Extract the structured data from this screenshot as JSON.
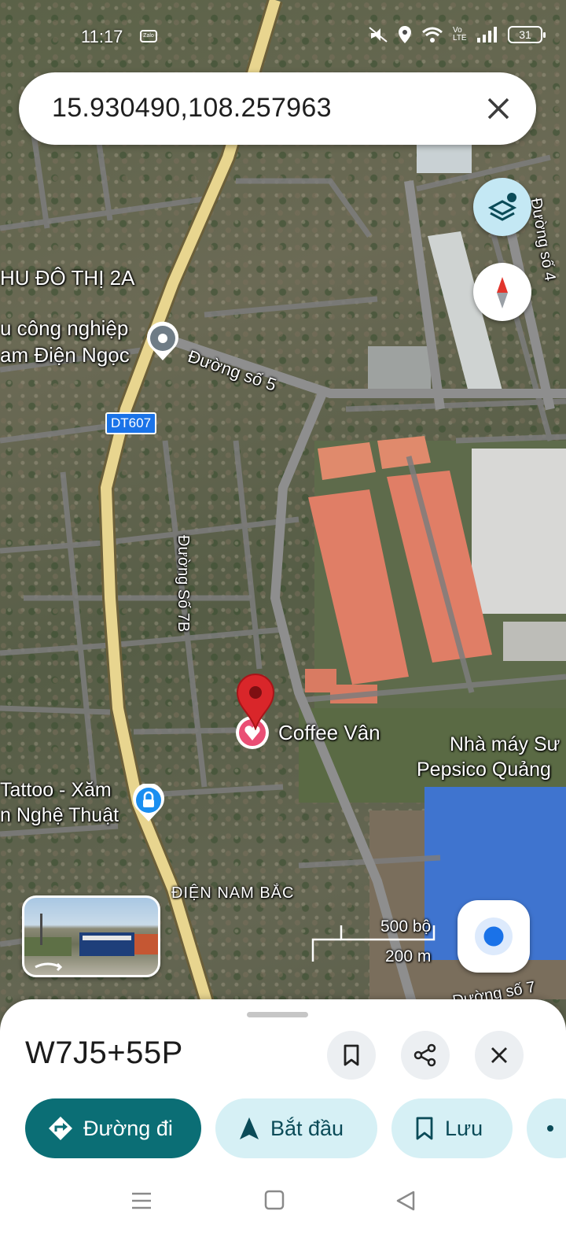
{
  "status_bar": {
    "time": "11:17",
    "notification_app": "Zalo",
    "network_label": "Vo LTE",
    "battery": "31",
    "icons": [
      "mute-icon",
      "location-icon",
      "wifi-icon",
      "volte-icon",
      "signal-icon",
      "battery-icon"
    ]
  },
  "search": {
    "query": "15.930490,108.257963",
    "clear_icon": "close-icon"
  },
  "map": {
    "labels": {
      "area_north": "HU ĐÔ THỊ 2A",
      "industrial_line1": "u công nghiệp",
      "industrial_line2": "am Điện Ngọc",
      "road_5": "Đường số 5",
      "road_4": "Đường số 4",
      "route_badge": "DT607",
      "road_7b": "Đường Số 7B",
      "coffee": "Coffee Vân",
      "factory_line1": "Nhà máy Sư",
      "factory_line2": "Pepsico Quảng",
      "tattoo_line1": "Tattoo - Xăm",
      "tattoo_line2": "n Nghệ Thuật",
      "district_south": "ĐIỆN NAM BẮC",
      "road_7": "Đường số 7"
    },
    "scale": {
      "imperial": "500 bộ",
      "metric": "200 m"
    },
    "controls": {
      "layers": "layers-icon",
      "compass": "compass-icon",
      "my_location": "my-location-icon",
      "street_view": "street-view-thumbnail"
    },
    "colors": {
      "highway": "#e8d58f",
      "pin_red": "#d9262a",
      "badge_blue": "#1a73e8",
      "roof_orange": "#e07e66"
    }
  },
  "sheet": {
    "plus_code": "W7J5+55P",
    "buttons": {
      "save_icon": "bookmark-icon",
      "share_icon": "share-icon",
      "close_icon": "close-icon"
    },
    "chips": {
      "directions": "Đường đi",
      "start": "Bắt đầu",
      "save": "Lưu"
    }
  },
  "nav_bar": {
    "icons": [
      "menu-icon",
      "home-icon",
      "back-icon"
    ]
  }
}
